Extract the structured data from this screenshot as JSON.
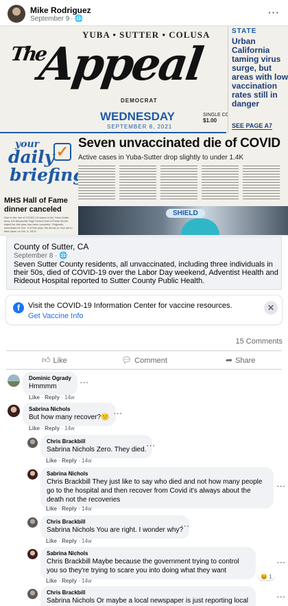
{
  "post": {
    "author": "Mike Rodriguez",
    "date": "September 9",
    "audience_icon": "globe-icon"
  },
  "newspaper": {
    "counties": "YUBA • SUTTER • COLUSA",
    "flag_the": "The",
    "flag_name": "Appeal",
    "democrat": "DEMOCRAT",
    "day": "WEDNESDAY",
    "date": "SEPTEMBER 8, 2021",
    "single_copy": "SINGLE COPY",
    "price": "$1.00",
    "state_label": "STATE",
    "side_headline": "Urban California taming virus surge, but areas with low vaccination rates still in danger",
    "see_page": "SEE PAGE A7",
    "briefing_your": "your",
    "briefing_daily": "daily",
    "briefing_word": "briefing",
    "hof_headline": "MHS Hall of Fame dinner canceled",
    "hof_body": "Due to the rise of COVID-19 cases in the Yuba-Sutter area, the Marysville High School Hall of Fame dinner slated for this year has been canceled. Originally scheduled for Oct. 9 of this year, the dinner is now set to take place on Oct. 8, 2022.",
    "main_headline": "Seven unvaccinated die of COVID",
    "main_sub": "Active cases in Yuba-Sutter drop slightly to under 1.4K",
    "photo_label": "SHIELD"
  },
  "link_card": {
    "title": "County of Sutter, CA",
    "meta": "September 8 ·",
    "description": "Seven Sutter County residents, all unvaccinated, including three individuals in their 50s, died of COVID-19 over the Labor Day weekend, Adventist Health and Rideout Hospital reported to Sutter County Public Health."
  },
  "covid_banner": {
    "text": "Visit the COVID-19 Information Center for vaccine resources.",
    "link": "Get Vaccine Info",
    "close": "✕"
  },
  "comment_count": "15 Comments",
  "actions": {
    "like": "Like",
    "comment": "Comment",
    "share": "Share"
  },
  "comment_actions": {
    "like": "Like",
    "reply": "Reply",
    "sep": " · "
  },
  "comments": [
    {
      "author": "Dominic Ogrady",
      "text": "Hmmmm",
      "time": "14w"
    },
    {
      "author": "Sabrina Nichols",
      "text": "But how many recover?😕",
      "time": "14w"
    },
    {
      "author": "Chris Brackbill",
      "text": "Sabrina Nichols Zero. They died.",
      "time": "14w"
    },
    {
      "author": "Sabrina Nichols",
      "text": "Chris Brackbill They just like to say who died and not how many people go to the hospital and then recover from Covid it's always about the death not the recoveries",
      "time": "14w"
    },
    {
      "author": "Chris Brackbill",
      "text": "Sabrina Nichols You are right. I wonder why?",
      "time": "14w"
    },
    {
      "author": "Sabrina Nichols",
      "text": "Chris Brackbill Maybe because the government trying to control you so they're trying to scare you into doing what they want",
      "time": "14w",
      "reaction": "😆 1"
    },
    {
      "author": "Chris Brackbill",
      "text": "Sabrina Nichols Or maybe a local newspaper is just reporting local news"
    }
  ]
}
